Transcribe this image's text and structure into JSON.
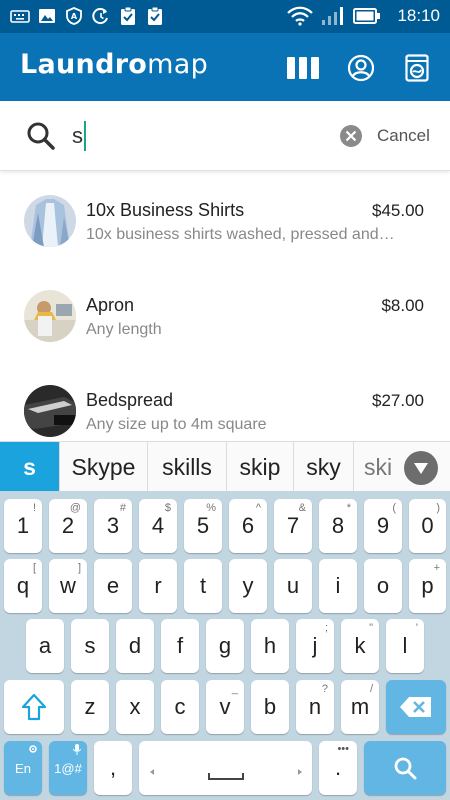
{
  "status_bar": {
    "time": "18:10",
    "icons": [
      "keyboard-icon",
      "image-icon",
      "shield-icon",
      "sync-icon",
      "clipboard-check-icon",
      "clipboard-check-icon"
    ]
  },
  "app": {
    "name_bold": "Laundro",
    "name_thin": "map"
  },
  "appbar_actions": [
    "grid-icon",
    "account-icon",
    "washing-machine-icon"
  ],
  "search": {
    "value": "s",
    "cancel_label": "Cancel"
  },
  "items": [
    {
      "title": "10x Business Shirts",
      "subtitle": "10x business shirts washed, pressed and…",
      "price": "$45.00",
      "thumb": "shirts"
    },
    {
      "title": "Apron",
      "subtitle": "Any length",
      "price": "$8.00",
      "thumb": "apron"
    },
    {
      "title": "Bedspread",
      "subtitle": "Any size up to 4m square",
      "price": "$27.00",
      "thumb": "bedspread"
    }
  ],
  "suggestions": [
    "s",
    "Skype",
    "skills",
    "skip",
    "sky",
    "ski"
  ],
  "keyboard": {
    "row_numbers": [
      {
        "label": "1",
        "hint": "!"
      },
      {
        "label": "2",
        "hint": "@"
      },
      {
        "label": "3",
        "hint": "#"
      },
      {
        "label": "4",
        "hint": "$"
      },
      {
        "label": "5",
        "hint": "%"
      },
      {
        "label": "6",
        "hint": "^"
      },
      {
        "label": "7",
        "hint": "&"
      },
      {
        "label": "8",
        "hint": "*"
      },
      {
        "label": "9",
        "hint": "("
      },
      {
        "label": "0",
        "hint": ")"
      }
    ],
    "row1": [
      {
        "label": "q",
        "hint": "["
      },
      {
        "label": "w",
        "hint": "]"
      },
      {
        "label": "e",
        "hint": ""
      },
      {
        "label": "r",
        "hint": ""
      },
      {
        "label": "t",
        "hint": ""
      },
      {
        "label": "y",
        "hint": ""
      },
      {
        "label": "u",
        "hint": ""
      },
      {
        "label": "i",
        "hint": ""
      },
      {
        "label": "o",
        "hint": ""
      },
      {
        "label": "p",
        "hint": "+"
      }
    ],
    "row2": [
      {
        "label": "a",
        "hint": ""
      },
      {
        "label": "s",
        "hint": ""
      },
      {
        "label": "d",
        "hint": ""
      },
      {
        "label": "f",
        "hint": ""
      },
      {
        "label": "g",
        "hint": ""
      },
      {
        "label": "h",
        "hint": ""
      },
      {
        "label": "j",
        "hint": ";"
      },
      {
        "label": "k",
        "hint": "\""
      },
      {
        "label": "l",
        "hint": "'"
      }
    ],
    "row3": [
      {
        "label": "z",
        "hint": ""
      },
      {
        "label": "x",
        "hint": ""
      },
      {
        "label": "c",
        "hint": ""
      },
      {
        "label": "v",
        "hint": "_"
      },
      {
        "label": "b",
        "hint": ""
      },
      {
        "label": "n",
        "hint": "?"
      },
      {
        "label": "m",
        "hint": "/"
      }
    ],
    "lang_label": "En",
    "symbols_label": "1@#",
    "comma_label": ",",
    "period_label": "."
  },
  "colors": {
    "appbar": "#0a73b5",
    "statusbar": "#005a94",
    "accent": "#1aa3dc",
    "key_blue": "#62b6e3"
  }
}
